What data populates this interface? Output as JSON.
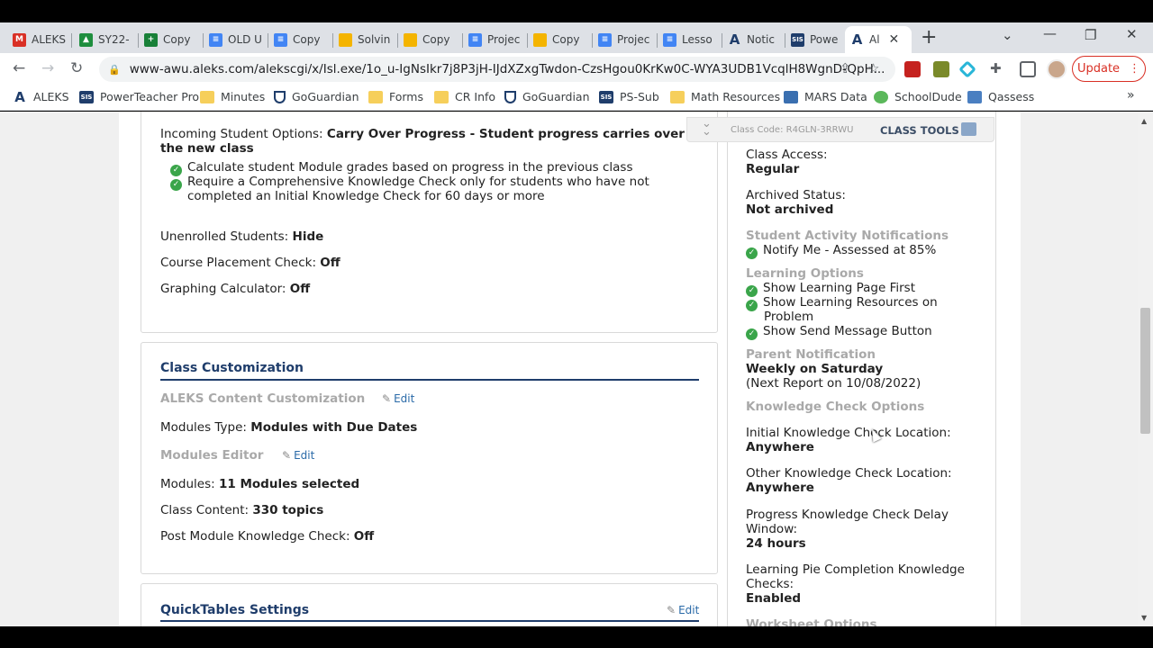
{
  "tabs": [
    {
      "label": "ALEKS",
      "icon": "gmail-icon",
      "color": "#d93025"
    },
    {
      "label": "SY22-",
      "icon": "drive-icon",
      "color": "#1e8e3e"
    },
    {
      "label": "Copy",
      "icon": "sheets-icon",
      "color": "#188038"
    },
    {
      "label": "OLD U",
      "icon": "docs-icon",
      "color": "#4285f4"
    },
    {
      "label": "Copy",
      "icon": "docs-icon",
      "color": "#4285f4"
    },
    {
      "label": "Solvin",
      "icon": "slides-icon",
      "color": "#f4b400"
    },
    {
      "label": "Copy",
      "icon": "slides-icon",
      "color": "#f4b400"
    },
    {
      "label": "Projec",
      "icon": "docs-icon",
      "color": "#4285f4"
    },
    {
      "label": "Copy",
      "icon": "slides-icon",
      "color": "#f4b400"
    },
    {
      "label": "Projec",
      "icon": "docs-icon",
      "color": "#4285f4"
    },
    {
      "label": "Lesso",
      "icon": "docs-icon",
      "color": "#4285f4"
    },
    {
      "label": "Notic",
      "icon": "aleks-icon",
      "color": "#1f3d6b"
    },
    {
      "label": "Powe",
      "icon": "sis-icon",
      "color": "#1f3d6b"
    },
    {
      "label": "Al",
      "icon": "aleks-icon",
      "color": "#1f3d6b"
    }
  ],
  "url": "www-awu.aleks.com/alekscgi/x/Isl.exe/1o_u-IgNsIkr7j8P3jH-IJdXZxgTwdon-CzsHgou0KrKw0C-WYA3UDB1VcqlH8WgnD-QpH...",
  "update_label": "Update",
  "bookmarks": [
    {
      "label": "ALEKS",
      "icon": "aleks-icon"
    },
    {
      "label": "PowerTeacher Pro",
      "icon": "sis-icon"
    },
    {
      "label": "Minutes",
      "icon": "folder-icon"
    },
    {
      "label": "GoGuardian",
      "icon": "shield-icon"
    },
    {
      "label": "Forms",
      "icon": "folder-icon"
    },
    {
      "label": "CR Info",
      "icon": "folder-icon"
    },
    {
      "label": "GoGuardian",
      "icon": "shield-icon"
    },
    {
      "label": "PS-Sub",
      "icon": "sis-icon"
    },
    {
      "label": "Math Resources",
      "icon": "folder-icon"
    },
    {
      "label": "MARS Data",
      "icon": "mars-icon"
    },
    {
      "label": "SchoolDude",
      "icon": "schooldude-icon"
    },
    {
      "label": "Qassess",
      "icon": "qassess-icon"
    }
  ],
  "incoming": {
    "label": "Incoming Student Options:",
    "value_line1": "Carry Over Progress - Student progress carries over t",
    "value_line2": "the new class",
    "bullet1": "Calculate student Module grades based on progress in the previous class",
    "bullet2_line1": "Require a Comprehensive Knowledge Check only for students who have not",
    "bullet2_line2": "completed an Initial Knowledge Check for 60 days or more"
  },
  "settings1": [
    {
      "label": "Unenrolled Students:",
      "value": "Hide"
    },
    {
      "label": "Course Placement Check:",
      "value": "Off"
    },
    {
      "label": "Graphing Calculator:",
      "value": "Off"
    }
  ],
  "customization": {
    "title": "Class Customization",
    "content_head": "ALEKS Content Customization",
    "edit": "Edit",
    "modules_type_label": "Modules Type:",
    "modules_type_value": "Modules with Due Dates",
    "editor_head": "Modules Editor",
    "modules_label": "Modules:",
    "modules_value": "11 Modules selected",
    "content_label": "Class Content:",
    "content_value": "330 topics",
    "post_label": "Post Module Knowledge Check:",
    "post_value": "Off"
  },
  "quicktables": {
    "title": "QuickTables Settings",
    "edit": "Edit"
  },
  "class_tools": {
    "code": "Class Code: R4GLN-3RRWU",
    "label": "CLASS TOOLS"
  },
  "right": {
    "access_label": "Class Access:",
    "access_value": "Regular",
    "archived_label": "Archived Status:",
    "archived_value": "Not archived",
    "notif_head": "Student Activity Notifications",
    "notif_item": "Notify Me - Assessed at 85%",
    "learning_head": "Learning Options",
    "learning1": "Show Learning Page First",
    "learning2_line1": "Show Learning Resources on",
    "learning2_line2": "Problem",
    "learning3": "Show Send Message Button",
    "parent_head": "Parent Notification",
    "parent_value": "Weekly on Saturday",
    "parent_next": "(Next Report on 10/08/2022)",
    "kc_head": "Knowledge Check Options",
    "initial_label": "Initial Knowledge Check Location:",
    "initial_value": "Anywhere",
    "other_label": "Other Knowledge Check Location:",
    "other_value": "Anywhere",
    "delay_label_line1": "Progress Knowledge Check Delay",
    "delay_label_line2": "Window:",
    "delay_value": "24 hours",
    "pie_label_line1": "Learning Pie Completion Knowledge",
    "pie_label_line2": "Checks:",
    "pie_value": "Enabled",
    "worksheet_head": "Worksheet Options"
  }
}
